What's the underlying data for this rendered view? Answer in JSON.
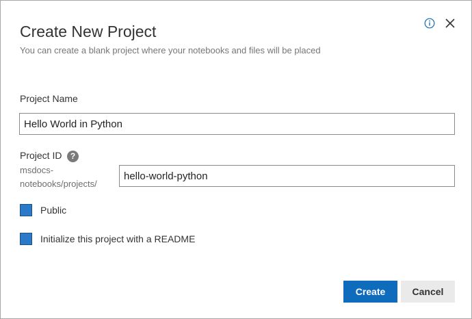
{
  "dialog": {
    "title": "Create New Project",
    "subtitle": "You can create a blank project where your notebooks and files will be placed",
    "info_icon": "info-icon",
    "close_icon": "close-icon"
  },
  "form": {
    "project_name": {
      "label": "Project Name",
      "value": "Hello World in Python"
    },
    "project_id": {
      "label": "Project ID",
      "help_glyph": "?",
      "prefix_line1": "msdocs-",
      "prefix_line2": "notebooks/projects/",
      "value": "hello-world-python"
    },
    "public": {
      "label": "Public",
      "checked": true
    },
    "readme": {
      "label": "Initialize this project with a README",
      "checked": true
    }
  },
  "actions": {
    "create_label": "Create",
    "cancel_label": "Cancel"
  },
  "colors": {
    "accent": "#0f6cbd",
    "checkbox": "#2b79c9",
    "secondary_button": "#eaeaea"
  }
}
